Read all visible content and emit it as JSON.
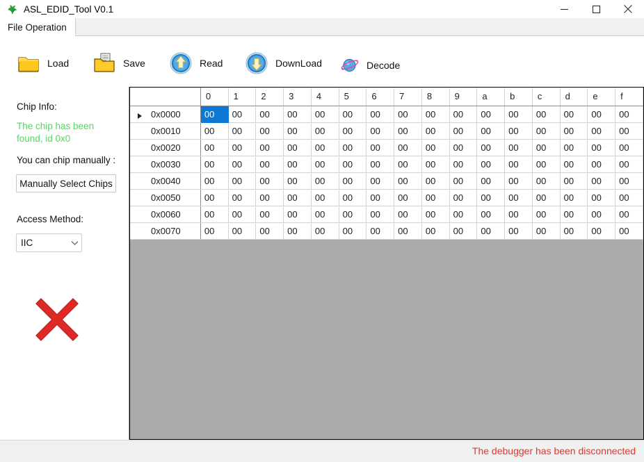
{
  "window": {
    "title": "ASL_EDID_Tool V0.1",
    "app_icon": "leaf-icon",
    "controls": {
      "minimize": "minimize-icon",
      "maximize": "maximize-icon",
      "close": "close-icon"
    }
  },
  "tabs": [
    {
      "label": "File Operation",
      "active": true
    }
  ],
  "toolbar": {
    "buttons": [
      {
        "id": "load",
        "label": "Load",
        "icon": "folder-icon"
      },
      {
        "id": "save",
        "label": "Save",
        "icon": "folder-document-icon"
      },
      {
        "id": "read",
        "label": "Read",
        "icon": "arrow-up-circle-icon"
      },
      {
        "id": "download",
        "label": "DownLoad",
        "icon": "arrow-down-circle-icon"
      },
      {
        "id": "decode",
        "label": "Decode",
        "icon": "planet-icon"
      }
    ]
  },
  "left_panel": {
    "chip_info_label": "Chip Info:",
    "chip_info_value": "The chip has been found, id 0x0",
    "chip_info_color": "#4ddb5b",
    "manual_hint": "You can chip manually :",
    "select_chips_button": "Manually Select Chips",
    "access_method_label": "Access Method:",
    "access_method": {
      "value": "IIC",
      "options": [
        "IIC"
      ]
    },
    "status_image": "red-x-icon",
    "status_image_color": "#de2a26"
  },
  "grid": {
    "corner_header": "",
    "column_headers": [
      "0",
      "1",
      "2",
      "3",
      "4",
      "5",
      "6",
      "7",
      "8",
      "9",
      "a",
      "b",
      "c",
      "d",
      "e",
      "f"
    ],
    "row_headers": [
      "0x0000",
      "0x0010",
      "0x0020",
      "0x0030",
      "0x0040",
      "0x0050",
      "0x0060",
      "0x0070"
    ],
    "current_row_index": 0,
    "selected_cell": {
      "row": 0,
      "col": 0
    },
    "selection_color": "#0c7ad4",
    "empty_area_color": "#ababab",
    "rows": [
      [
        "00",
        "00",
        "00",
        "00",
        "00",
        "00",
        "00",
        "00",
        "00",
        "00",
        "00",
        "00",
        "00",
        "00",
        "00",
        "00"
      ],
      [
        "00",
        "00",
        "00",
        "00",
        "00",
        "00",
        "00",
        "00",
        "00",
        "00",
        "00",
        "00",
        "00",
        "00",
        "00",
        "00"
      ],
      [
        "00",
        "00",
        "00",
        "00",
        "00",
        "00",
        "00",
        "00",
        "00",
        "00",
        "00",
        "00",
        "00",
        "00",
        "00",
        "00"
      ],
      [
        "00",
        "00",
        "00",
        "00",
        "00",
        "00",
        "00",
        "00",
        "00",
        "00",
        "00",
        "00",
        "00",
        "00",
        "00",
        "00"
      ],
      [
        "00",
        "00",
        "00",
        "00",
        "00",
        "00",
        "00",
        "00",
        "00",
        "00",
        "00",
        "00",
        "00",
        "00",
        "00",
        "00"
      ],
      [
        "00",
        "00",
        "00",
        "00",
        "00",
        "00",
        "00",
        "00",
        "00",
        "00",
        "00",
        "00",
        "00",
        "00",
        "00",
        "00"
      ],
      [
        "00",
        "00",
        "00",
        "00",
        "00",
        "00",
        "00",
        "00",
        "00",
        "00",
        "00",
        "00",
        "00",
        "00",
        "00",
        "00"
      ],
      [
        "00",
        "00",
        "00",
        "00",
        "00",
        "00",
        "00",
        "00",
        "00",
        "00",
        "00",
        "00",
        "00",
        "00",
        "00",
        "00"
      ]
    ]
  },
  "status_bar": {
    "message": "The debugger has been disconnected",
    "message_color": "#e8352b",
    "grip": "resize-grip-icon"
  }
}
